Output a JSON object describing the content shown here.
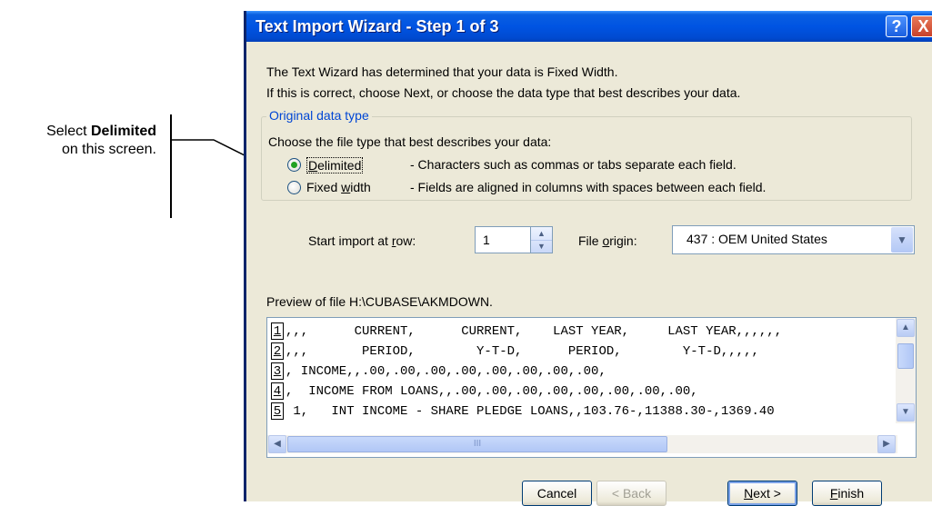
{
  "callout": {
    "line1_prefix": "Select ",
    "line1_bold": "Delimited",
    "line2": "on this screen."
  },
  "window": {
    "title": "Text Import Wizard - Step 1 of 3",
    "help_label": "?",
    "close_label": "X",
    "description_line1": "The Text Wizard has determined that your data is Fixed Width.",
    "description_line2": "If this is correct, choose Next, or choose the data type that best describes your data."
  },
  "original_data_type": {
    "legend": "Original data type",
    "prompt": "Choose the file type that best describes your data:",
    "options": [
      {
        "label_pre": "",
        "label_u": "D",
        "label_post": "elimited",
        "description": "- Characters such as commas or tabs separate each field.",
        "selected": true
      },
      {
        "label_pre": "Fixed ",
        "label_u": "w",
        "label_post": "idth",
        "description": "- Fields are aligned in columns with spaces between each field.",
        "selected": false
      }
    ]
  },
  "import_options": {
    "start_row_pre": "Start import at ",
    "start_row_u": "r",
    "start_row_post": "ow:",
    "start_row_value": "1",
    "file_origin_pre": "File ",
    "file_origin_u": "o",
    "file_origin_post": "rigin:",
    "file_origin_value": "437 : OEM United States"
  },
  "preview": {
    "label": "Preview of file H:\\CUBASE\\AKMDOWN.",
    "lines": [
      {
        "num": "1",
        "text": ",,,      CURRENT,      CURRENT,    LAST YEAR,     LAST YEAR,,,,,,"
      },
      {
        "num": "2",
        "text": ",,,       PERIOD,        Y-T-D,      PERIOD,        Y-T-D,,,,,"
      },
      {
        "num": "3",
        "text": ", INCOME,,.00,.00,.00,.00,.00,.00,.00,.00,"
      },
      {
        "num": "4",
        "text": ",  INCOME FROM LOANS,,.00,.00,.00,.00,.00,.00,.00,.00,"
      },
      {
        "num": "5",
        "text": " 1,   INT INCOME - SHARE PLEDGE LOANS,,103.76-,11388.30-,1369.40"
      }
    ],
    "hthumb_grip": "III"
  },
  "buttons": {
    "cancel": "Cancel",
    "back": "< Back",
    "next_u": "N",
    "next_post": "ext >",
    "finish_u": "F",
    "finish_post": "inish"
  },
  "colors": {
    "titlebar": "#0054e3",
    "dialog_bg": "#ece9d8",
    "group_legend": "#0046d5",
    "radio_dot": "#21a121"
  }
}
